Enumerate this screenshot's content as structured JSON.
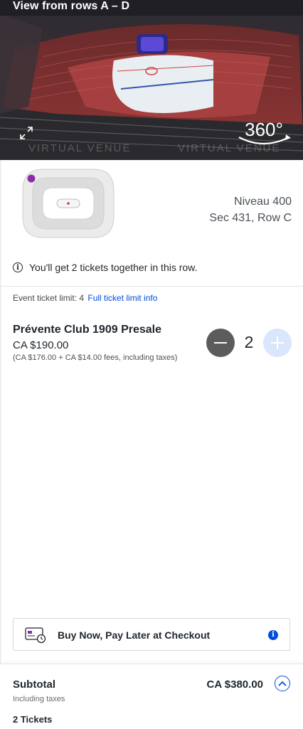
{
  "hero": {
    "title": "View from rows A – D",
    "badge_360": "360°",
    "watermark": "VIRTUAL VENUE",
    "icons": [
      "expand-icon",
      "rotate-360-icon"
    ]
  },
  "section": {
    "level": "Niveau 400",
    "location": "Sec 431, Row C"
  },
  "together_notice": "You'll get 2 tickets together in this row.",
  "limit": {
    "label": "Event ticket limit: 4",
    "link": "Full ticket limit info"
  },
  "ticket": {
    "name": "Prévente Club 1909 Presale",
    "price": "CA $190.00",
    "fees": "(CA $176.00 + CA $14.00 fees, including taxes)",
    "quantity": "2"
  },
  "bnpl": {
    "label": "Buy Now, Pay Later at Checkout"
  },
  "footer": {
    "subtotal_label": "Subtotal",
    "subtotal_sub": "Including taxes",
    "subtotal_amount": "CA $380.00",
    "tickets_count": "2 Tickets"
  },
  "colors": {
    "accent": "#024ddf",
    "seat_dot": "#8b2fa8",
    "minus_button": "#5c5c5c",
    "plus_button_disabled": "#d9e6fb"
  }
}
